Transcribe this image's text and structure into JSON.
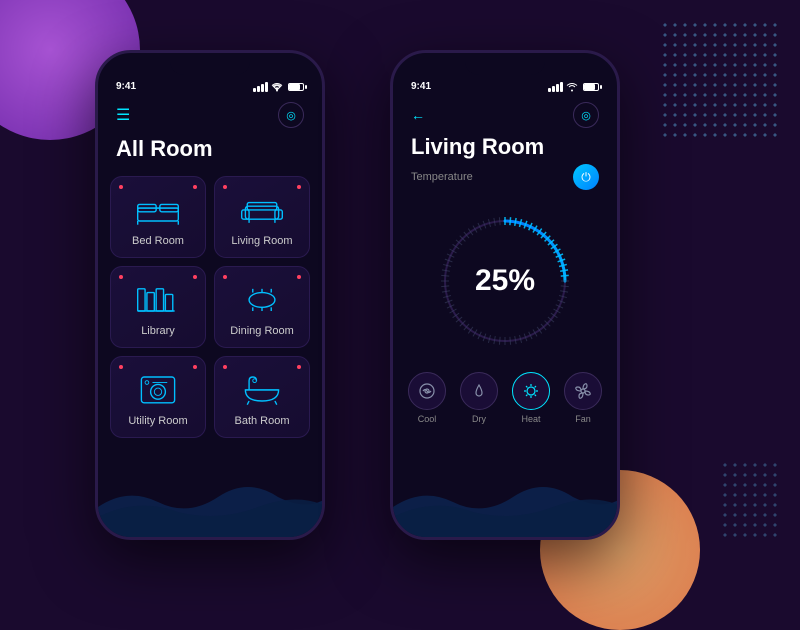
{
  "background": {
    "color": "#1a0a2e"
  },
  "phone1": {
    "status_time": "9:41",
    "header_icon": "☰",
    "title": "All Room",
    "rooms": [
      {
        "name": "Bed Room",
        "icon": "bed"
      },
      {
        "name": "Living Room",
        "icon": "sofa"
      },
      {
        "name": "Library",
        "icon": "library"
      },
      {
        "name": "Dining Room",
        "icon": "dining"
      },
      {
        "name": "Utility Room",
        "icon": "washer"
      },
      {
        "name": "Bath Room",
        "icon": "bath"
      }
    ]
  },
  "phone2": {
    "status_time": "9:41",
    "title": "Living Room",
    "temp_label": "Temperature",
    "percent": "25%",
    "controls": [
      {
        "name": "Cool",
        "active": false
      },
      {
        "name": "Dry",
        "active": false
      },
      {
        "name": "Heat",
        "active": true
      },
      {
        "name": "Fan",
        "active": false
      }
    ]
  }
}
